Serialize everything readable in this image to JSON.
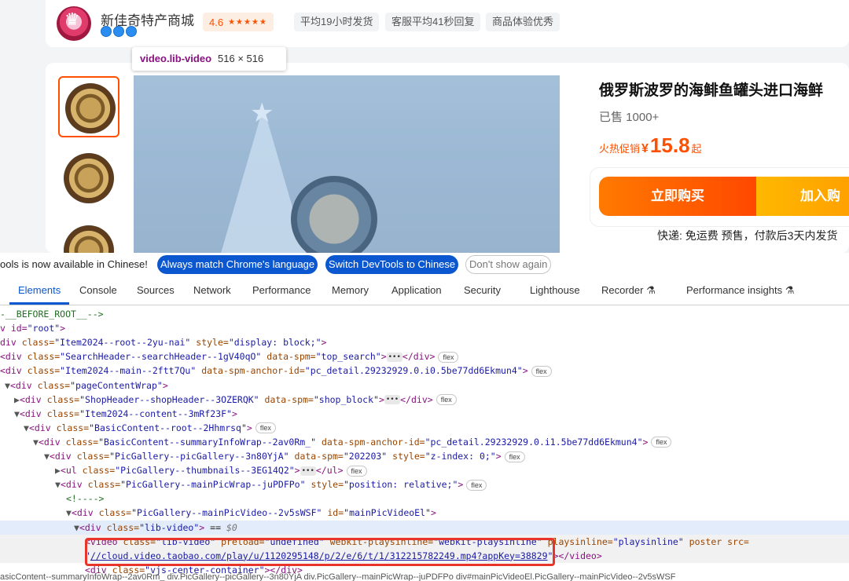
{
  "shop": {
    "name": "新佳奇特产商城",
    "rating": "4.6",
    "stars": "★★★★★",
    "tags": [
      "平均19小时发货",
      "客服平均41秒回复",
      "商品体验优秀"
    ]
  },
  "tooltip": {
    "name": "video.lib-video",
    "size": "516 × 516"
  },
  "product": {
    "title": "俄罗斯波罗的海鲱鱼罐头进口海鲜",
    "sold": "已售 1000+",
    "promo_label": "火热促销",
    "currency": "¥",
    "price": "15.8",
    "price_suffix": "起",
    "buy_label": "立即购买",
    "cart_label": "加入购物",
    "shipping": "快递: 免运费  预售，付款后3天内发货"
  },
  "devtools": {
    "notice": "ools is now available in Chinese!",
    "btn_match": "Always match Chrome's language",
    "btn_switch": "Switch DevTools to Chinese",
    "btn_dont": "Don't show again",
    "tabs": [
      "Elements",
      "Console",
      "Sources",
      "Network",
      "Performance",
      "Memory",
      "Application",
      "Security",
      "Lighthouse",
      "Recorder ⚗",
      "Performance insights ⚗"
    ],
    "lines": [
      {
        "indent": 0,
        "html": "<span class='cmt'>-__BEFORE_ROOT__--></span>"
      },
      {
        "indent": 0,
        "html": "<span class='tagc'>v id=</span><span class='val'>\"root\"</span><span class='tagc'>></span>"
      },
      {
        "indent": 0,
        "html": "<span class='tagc'>div </span><span class='attr'>class=</span><span class='val'>\"Item2024--root--2yu-nai\"</span> <span class='attr'>style=</span><span class='val'>\"display: block;\"</span><span class='tagc'>></span>"
      },
      {
        "indent": 0,
        "html": "<span class='tagc'>&lt;div </span><span class='attr'>class=</span><span class='val'>\"SearchHeader--searchHeader--1gV40qO\"</span> <span class='attr'>data-spm=</span><span class='val'>\"top_search\"</span><span class='tagc'>></span><span class='ell'>•••</span><span class='tagc'>&lt;/div></span><span class='badge'>flex</span>"
      },
      {
        "indent": 0,
        "html": "<span class='tagc'>&lt;div </span><span class='attr'>class=</span><span class='val'>\"Item2024--main--2ftt7Qu\"</span> <span class='attr'>data-spm-anchor-id=</span><span class='val'>\"pc_detail.29232929.0.i0.5be77dd6Ekmun4\"</span><span class='tagc'>></span><span class='badge'>flex</span>"
      },
      {
        "indent": 1,
        "html": "<span class='tri'>▼</span><span class='tagc'>&lt;div </span><span class='attr'>class=</span><span class='val'>\"pageContentWrap\"</span><span class='tagc'>></span>"
      },
      {
        "indent": 2,
        "html": "<span class='tri'>▶</span><span class='tagc'>&lt;div </span><span class='attr'>class=</span><span class='val'>\"ShopHeader--shopHeader--3OZERQK\"</span> <span class='attr'>data-spm=</span><span class='val'>\"shop_block\"</span><span class='tagc'>></span><span class='ell'>•••</span><span class='tagc'>&lt;/div></span><span class='badge'>flex</span>"
      },
      {
        "indent": 2,
        "html": "<span class='tri'>▼</span><span class='tagc'>&lt;div </span><span class='attr'>class=</span><span class='val'>\"Item2024--content--3mRf23F\"</span><span class='tagc'>></span>"
      },
      {
        "indent": 3,
        "html": "<span class='tri'>▼</span><span class='tagc'>&lt;div </span><span class='attr'>class=</span><span class='val'>\"BasicContent--root--2Hhmrsq\"</span><span class='tagc'>></span><span class='badge'>flex</span>"
      },
      {
        "indent": 4,
        "html": "<span class='tri'>▼</span><span class='tagc'>&lt;div </span><span class='attr'>class=</span><span class='val'>\"BasicContent--summaryInfoWrap--2av0Rm_\"</span> <span class='attr'>data-spm-anchor-id=</span><span class='val'>\"pc_detail.29232929.0.i1.5be77dd6Ekmun4\"</span><span class='tagc'>></span><span class='badge'>flex</span>"
      },
      {
        "indent": 5,
        "html": "<span class='tri'>▼</span><span class='tagc'>&lt;div </span><span class='attr'>class=</span><span class='val'>\"PicGallery--picGallery--3n80YjA\"</span> <span class='attr'>data-spm=</span><span class='val'>\"202203\"</span> <span class='attr'>style=</span><span class='val'>\"z-index: 0;\"</span><span class='tagc'>></span><span class='badge'>flex</span>"
      },
      {
        "indent": 6,
        "html": "<span class='tri'>▶</span><span class='tagc'>&lt;ul </span><span class='attr'>class=</span><span class='val'>\"PicGallery--thumbnails--3EG14Q2\"</span><span class='tagc'>></span><span class='ell'>•••</span><span class='tagc'>&lt;/ul></span><span class='badge'>flex</span>"
      },
      {
        "indent": 6,
        "html": "<span class='tri'>▼</span><span class='tagc'>&lt;div </span><span class='attr'>class=</span><span class='val'>\"PicGallery--mainPicWrap--juPDFPo\"</span> <span class='attr'>style=</span><span class='val'>\"position: relative;\"</span><span class='tagc'>></span><span class='badge'>flex</span>"
      },
      {
        "indent": 7,
        "html": "<span class='cmt'>&lt;!----></span>"
      },
      {
        "indent": 7,
        "html": "<span class='tri'>▼</span><span class='tagc'>&lt;div </span><span class='attr'>class=</span><span class='val'>\"PicGallery--mainPicVideo--2v5sWSF\"</span> <span class='attr'>id=</span><span class='val'>\"mainPicVideoEl\"</span><span class='tagc'>></span>"
      },
      {
        "indent": 8,
        "html": "<span class='tri'>▼</span><span class='tagc'>&lt;div </span><span class='attr'>class=</span><span class='val'>\"lib-video\"</span><span class='tagc'>></span> <span class='txt'>== </span><span style='color:#777;font-style:italic'>$0</span>"
      },
      {
        "indent": 9,
        "html": "<span class='tagc'>&lt;video </span><span class='attr'>class=</span><span class='val'>\"lib-video\"</span> <span class='attr'>preload=</span><span class='val'>\"undefined\"</span> <span class='attr'>webkit-playsinline=</span><span class='val'>\"webkit-playsinline\"</span> <span class='attr'>playsinline=</span><span class='val'>\"playsinline\"</span> <span class='attr'>poster src=</span>"
      },
      {
        "indent": 9,
        "html": "<span class='val'>\"</span><span class='url'>//cloud.video.taobao.com/play/u/1120295148/p/2/e/6/t/1/312215782249.mp4?appKey=38829</span><span class='val'>\"</span><span class='tagc'>>&lt;/video></span>"
      },
      {
        "indent": 9,
        "html": "<span class='tagc'>&lt;div </span><span class='attr'>class=</span><span class='val'>\"vjs-center-container\"</span><span class='tagc'>>&lt;/div></span>"
      }
    ],
    "crumb": "asicContent--summaryInfoWrap--2av0Rm_  div.PicGallery--picGallery--3n80YjA  div.PicGallery--mainPicWrap--juPDFPo  div#mainPicVideoEl.PicGallery--mainPicVideo--2v5sWSF"
  }
}
